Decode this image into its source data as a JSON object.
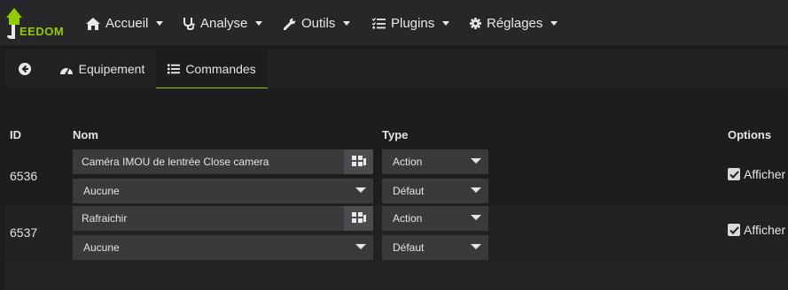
{
  "logo": {
    "text": "EEDOM",
    "icon": "jeedom-house-logo"
  },
  "nav": [
    {
      "label": "Accueil",
      "icon": "home-icon"
    },
    {
      "label": "Analyse",
      "icon": "stethoscope-icon"
    },
    {
      "label": "Outils",
      "icon": "wrench-icon"
    },
    {
      "label": "Plugins",
      "icon": "tasks-icon"
    },
    {
      "label": "Réglages",
      "icon": "cog-icon"
    }
  ],
  "tabs": {
    "back_icon": "arrow-circle-left-icon",
    "items": [
      {
        "label": "Equipement",
        "icon": "tachometer-icon",
        "active": false
      },
      {
        "label": "Commandes",
        "icon": "list-icon",
        "active": true
      }
    ]
  },
  "table": {
    "headers": {
      "id": "ID",
      "name": "Nom",
      "type": "Type",
      "options": "Options"
    },
    "rows": [
      {
        "id": "6536",
        "name": "Caméra IMOU de lentrée Close camera",
        "icon_select": "Aucune",
        "type": "Action",
        "subtype": "Défaut",
        "option_label": "Afficher",
        "checked": true
      },
      {
        "id": "6537",
        "name": "Rafraichir",
        "icon_select": "Aucune",
        "type": "Action",
        "subtype": "Défaut",
        "option_label": "Afficher",
        "checked": true
      }
    ]
  },
  "colors": {
    "accent": "#94ca02",
    "navbar": "#262729",
    "background": "#1c1d1f",
    "input": "#383a3c"
  }
}
